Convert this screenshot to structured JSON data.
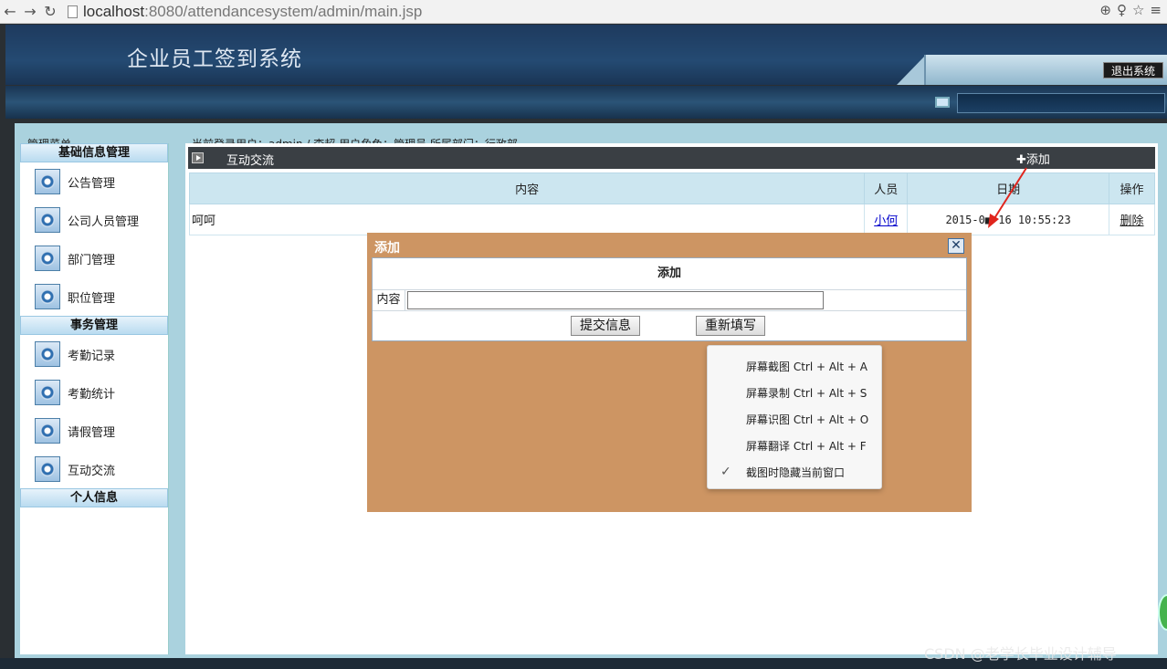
{
  "browser": {
    "url_host": "localhost",
    "url_path": ":8080/attendancesystem/admin/main.jsp"
  },
  "header": {
    "title": "企业员工签到系统",
    "logout_label": "退出系统"
  },
  "crumb": {
    "menu_label": "管理菜单",
    "user_info": "当前登录用户：admin / 李超    用户角色：管理员    所属部门：行政部"
  },
  "sidebar": {
    "groups": [
      {
        "title": "基础信息管理",
        "items": [
          {
            "label": "公告管理"
          },
          {
            "label": "公司人员管理"
          },
          {
            "label": "部门管理"
          },
          {
            "label": "职位管理"
          }
        ]
      },
      {
        "title": "事务管理",
        "items": [
          {
            "label": "考勤记录"
          },
          {
            "label": "考勤统计"
          },
          {
            "label": "请假管理"
          },
          {
            "label": "互动交流"
          }
        ]
      },
      {
        "title": "个人信息",
        "items": []
      }
    ]
  },
  "main": {
    "title": "互动交流",
    "add_label": "✚添加",
    "columns": [
      "内容",
      "人员",
      "日期",
      "操作"
    ],
    "rows": [
      {
        "content": "呵呵",
        "person": "小何",
        "date": "2015-0■-16 10:55:23",
        "op": "删除"
      }
    ]
  },
  "dialog": {
    "title": "添加",
    "close_label": "✕",
    "form_title": "添加",
    "field_label": "内容",
    "field_value": "",
    "submit_label": "提交信息",
    "reset_label": "重新填写"
  },
  "context_menu": {
    "items": [
      {
        "label": "屏幕截图 Ctrl + Alt + A"
      },
      {
        "label": "屏幕录制 Ctrl + Alt + S"
      },
      {
        "label": "屏幕识图 Ctrl + Alt + O"
      },
      {
        "label": "屏幕翻译 Ctrl + Alt + F"
      },
      {
        "label": "截图时隐藏当前窗口",
        "checked": true
      }
    ]
  },
  "watermark": "CSDN @老学长毕业设计辅导",
  "colors": {
    "header": "#244a72",
    "dialog": "#cd9563",
    "table_head": "#cce6f0",
    "main_bar": "#3a3f44"
  }
}
